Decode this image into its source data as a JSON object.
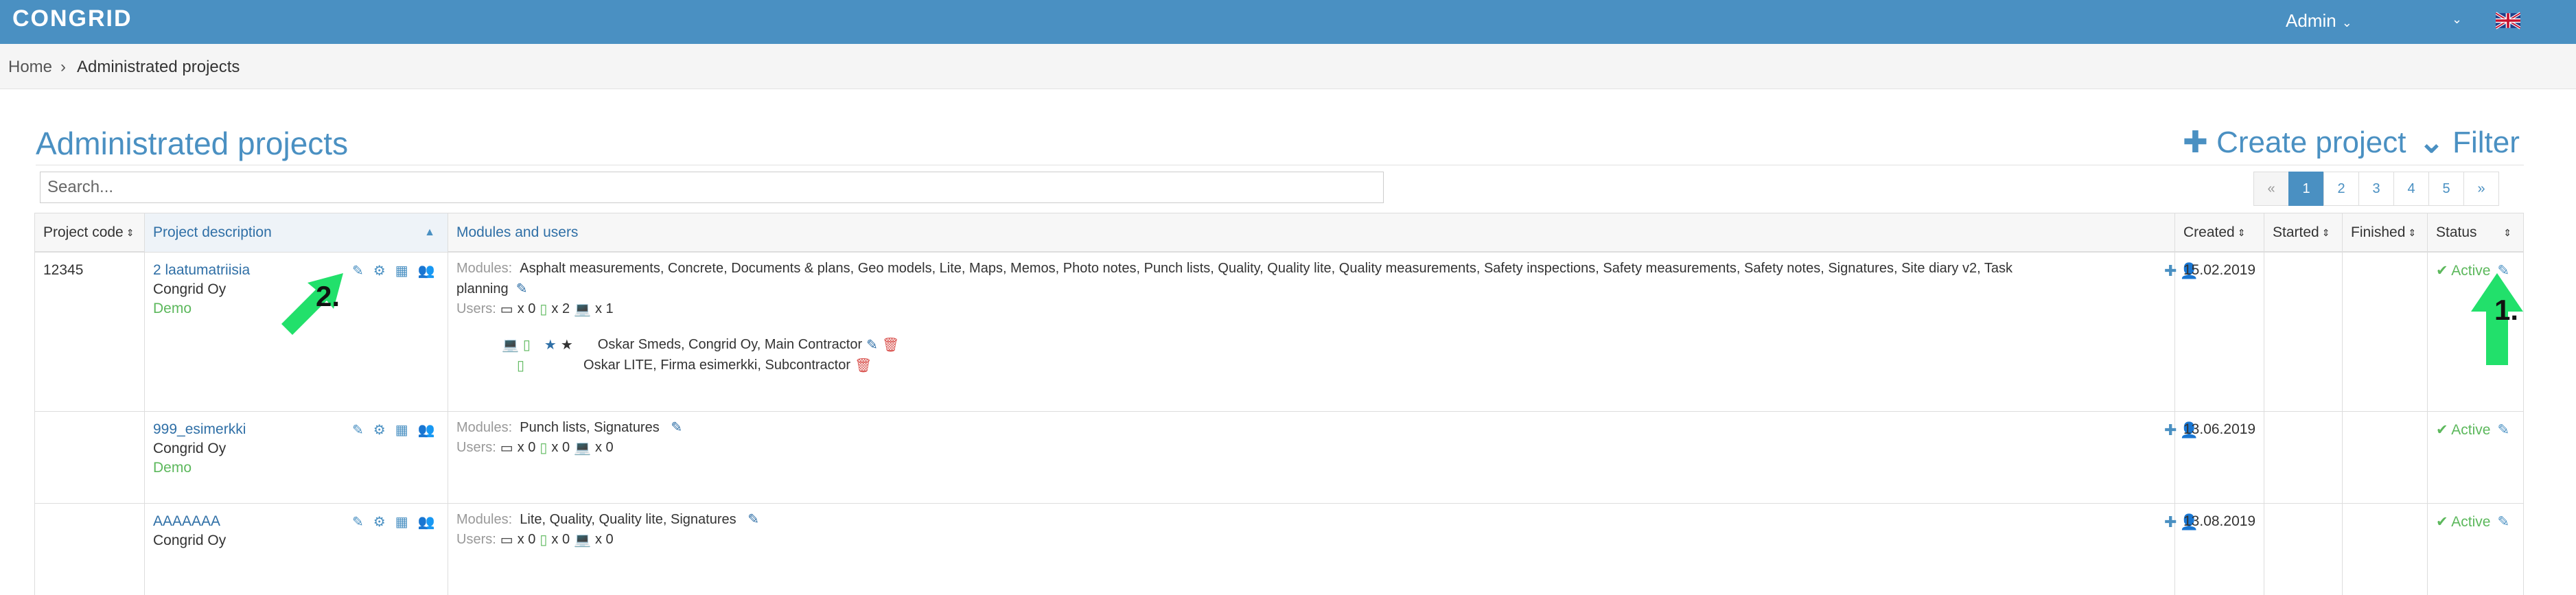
{
  "nav": {
    "logo": "CONGRID",
    "admin_label": "Admin",
    "flag_icon": "uk-flag-icon"
  },
  "breadcrumb": {
    "home": "Home",
    "separator": "›",
    "current": "Administrated projects"
  },
  "page": {
    "title": "Administrated projects",
    "create_label": "Create project",
    "filter_label": "Filter",
    "search_placeholder": "Search..."
  },
  "pagination": {
    "prev": "«",
    "pages": [
      "1",
      "2",
      "3",
      "4",
      "5"
    ],
    "next": "»",
    "active": "1"
  },
  "table": {
    "headers": {
      "code": "Project code",
      "description": "Project description",
      "modules": "Modules and users",
      "created": "Created",
      "started": "Started",
      "finished": "Finished",
      "status": "Status"
    },
    "labels": {
      "modules": "Modules:",
      "users": "Users:"
    },
    "rows": [
      {
        "code": "12345",
        "name": "2 laatumatriisia",
        "company": "Congrid Oy",
        "tag": "Demo",
        "modules_line1": "Asphalt measurements, Concrete, Documents & plans, Geo models, Lite, Maps, Memos, Photo notes, Punch lists, Quality, Quality lite, Quality measurements, Safety inspections, Safety measurements, Safety notes, Signatures, Site diary v2, Task",
        "modules_line2": "planning",
        "users": {
          "desktop": "x 0",
          "mobile": "x 2",
          "laptop": "x 1"
        },
        "members": [
          "Oskar Smeds, Congrid Oy, Main Contractor",
          "Oskar LITE, Firma esimerkki, Subcontractor"
        ],
        "created": "15.02.2019",
        "status": "Active"
      },
      {
        "code": "",
        "name": "999_esimerkki",
        "company": "Congrid Oy",
        "tag": "Demo",
        "modules_line1": "Punch lists, Signatures",
        "users": {
          "desktop": "x 0",
          "mobile": "x 0",
          "laptop": "x 0"
        },
        "created": "13.06.2019",
        "status": "Active"
      },
      {
        "code": "",
        "name": "AAAAAAA",
        "company": "Congrid Oy",
        "tag": "",
        "modules_line1": "Lite, Quality, Quality lite, Signatures",
        "users": {
          "desktop": "x 0",
          "mobile": "x 0",
          "laptop": "x 0"
        },
        "created": "13.08.2019",
        "status": "Active"
      }
    ]
  },
  "annotations": {
    "one": "1.",
    "two": "2.",
    "arrow_color": "#22e06b"
  },
  "colors": {
    "navbar": "#4a90c2",
    "link": "#2f6fa6",
    "active": "#5cb85c"
  }
}
